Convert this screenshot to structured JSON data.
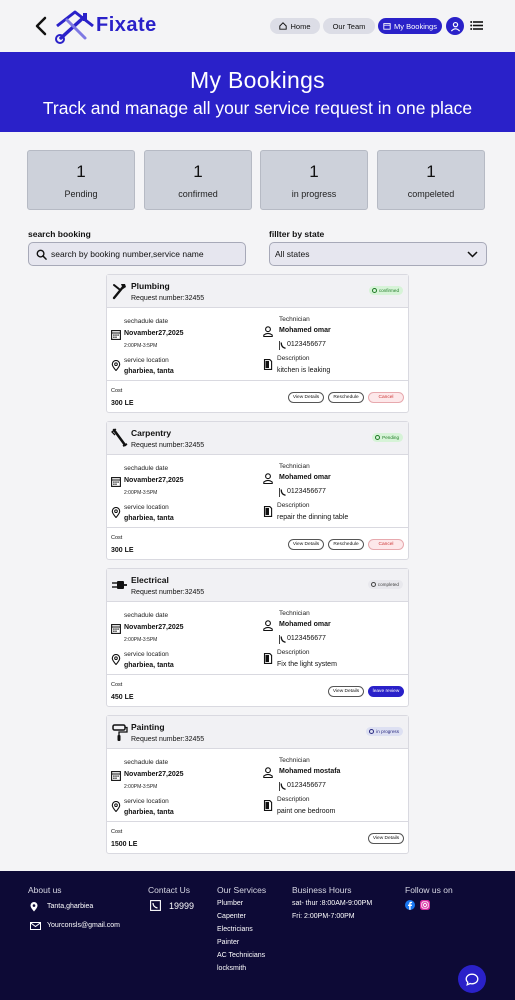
{
  "brand": {
    "name": "Fixate",
    "color": "#2a21c9"
  },
  "nav": {
    "home": "Home",
    "team": "Our Team",
    "bookings": "My Bookings"
  },
  "hero": {
    "title": "My Bookings",
    "subtitle": "Track and manage all your service request in one place"
  },
  "stats": [
    {
      "count": "1",
      "label": "Pending"
    },
    {
      "count": "1",
      "label": "confirmed"
    },
    {
      "count": "1",
      "label": "in progress"
    },
    {
      "count": "1",
      "label": "compeleted"
    }
  ],
  "search": {
    "label": "search booking",
    "placeholder": "search by booking number,service name"
  },
  "filter": {
    "label": "fillter by state",
    "selected": "All states"
  },
  "card_labels": {
    "schedule": "sechadule date",
    "location": "service location",
    "technician": "Technician",
    "description": "Description",
    "cost": "Cost"
  },
  "bookings": [
    {
      "service": "Plumbing",
      "request": "Request number:32455",
      "status": "confirmed",
      "date": "Novamber27,2025",
      "time": "2:00PM-3:5PM",
      "location": "gharbiea, tanta",
      "technician": "Mohamed omar",
      "phone": "0123456677",
      "description": "kitchen is leaking",
      "cost": "300 LE",
      "buttons": [
        "View Details",
        "Reschedule",
        "Cancel"
      ]
    },
    {
      "service": "Carpentry",
      "request": "Request number:32455",
      "status": "Pending",
      "date": "Novamber27,2025",
      "time": "2:00PM-3:5PM",
      "location": "gharbiea, tanta",
      "technician": "Mohamed omar",
      "phone": "0123456677",
      "description": "repair the dinning table",
      "cost": "300 LE",
      "buttons": [
        "View Details",
        "Reschedule",
        "Cancel"
      ]
    },
    {
      "service": "Electrical",
      "request": "Request number:32455",
      "status": "completed",
      "date": "Novamber27,2025",
      "time": "2:00PM-3:5PM",
      "location": "gharbiea, tanta",
      "technician": "Mohamed omar",
      "phone": "0123456677",
      "description": "Fix the light system",
      "cost": "450 LE",
      "buttons": [
        "View Details",
        "leave review"
      ]
    },
    {
      "service": "Painting",
      "request": "Request number:32455",
      "status": "in progress",
      "date": "Novamber27,2025",
      "time": "2:00PM-3:5PM",
      "location": "gharbiea, tanta",
      "technician": "Mohamed mostafa",
      "phone": "0123456677",
      "description": "paint one bedroom",
      "cost": "1500 LE",
      "buttons": [
        "View Details"
      ]
    }
  ],
  "footer": {
    "about_title": "About us",
    "address": "Tanta,gharbiea",
    "email": "Yourconsls@gmail.com",
    "contact_title": "Contact Us",
    "phone": "19999",
    "services_title": "Our Services",
    "services": [
      "Plumber",
      "Capenter",
      "Electricians",
      "Painter",
      "AC Technicians",
      "locksmith"
    ],
    "hours_title": "Business Hours",
    "hours": [
      "sat- thur :8:00AM-9:00PM",
      "Fri: 2:00PM-7:00PM"
    ],
    "follow_title": "Follow us on"
  }
}
